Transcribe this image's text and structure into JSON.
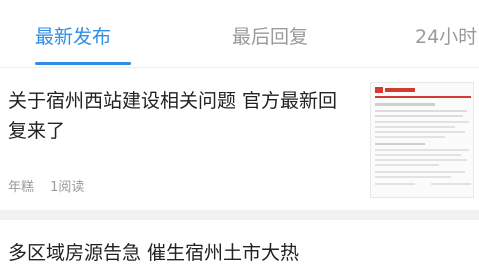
{
  "tabs": [
    {
      "label": "最新发布",
      "active": true
    },
    {
      "label": "最后回复",
      "active": false
    },
    {
      "label": "24小时",
      "active": false
    }
  ],
  "articles": [
    {
      "title": "关于宿州西站建设相关问题 官方最新回复来了",
      "author": "年糕",
      "reads": "1阅读",
      "has_thumbnail": true
    },
    {
      "title": "多区域房源告急 催生宿州土市大热"
    }
  ],
  "colors": {
    "accent": "#2f8ee6",
    "muted_text": "#9a9a9a",
    "title_text": "#222222",
    "thumbnail_header_red": "#d33b2f"
  }
}
